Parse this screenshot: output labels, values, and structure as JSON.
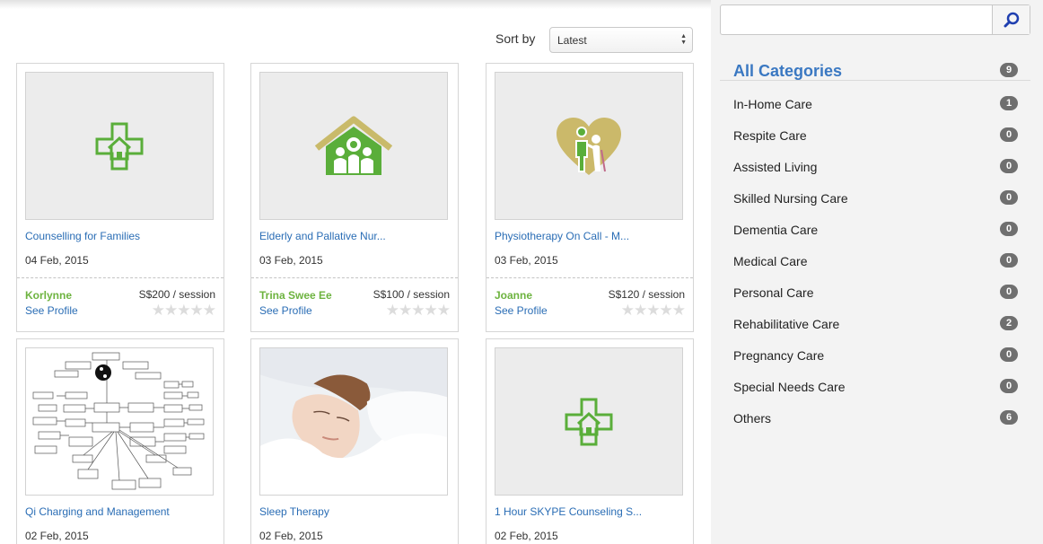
{
  "sort": {
    "label": "Sort by",
    "selected": "Latest"
  },
  "search": {
    "placeholder": ""
  },
  "categories_header": {
    "label": "All Categories",
    "count": "9"
  },
  "categories": [
    {
      "label": "In-Home Care",
      "count": "1"
    },
    {
      "label": "Respite Care",
      "count": "0"
    },
    {
      "label": "Assisted Living",
      "count": "0"
    },
    {
      "label": "Skilled Nursing Care",
      "count": "0"
    },
    {
      "label": "Dementia Care",
      "count": "0"
    },
    {
      "label": "Medical Care",
      "count": "0"
    },
    {
      "label": "Personal Care",
      "count": "0"
    },
    {
      "label": "Rehabilitative Care",
      "count": "2"
    },
    {
      "label": "Pregnancy Care",
      "count": "0"
    },
    {
      "label": "Special Needs Care",
      "count": "0"
    },
    {
      "label": "Others",
      "count": "6"
    }
  ],
  "listings": [
    {
      "title": "Counselling for Families",
      "date": "04 Feb, 2015",
      "provider": "Korlynne",
      "price": "S$200 / session",
      "profile_link": "See Profile",
      "image": "medical-house-icon",
      "rating": 0
    },
    {
      "title": "Elderly and Pallative Nur...",
      "date": "03 Feb, 2015",
      "provider": "Trina Swee Ee",
      "price": "S$100 / session",
      "profile_link": "See Profile",
      "image": "family-home-icon",
      "rating": 0
    },
    {
      "title": "Physiotherapy On Call - M...",
      "date": "03 Feb, 2015",
      "provider": "Joanne",
      "price": "S$120 / session",
      "profile_link": "See Profile",
      "image": "heart-caregiver-icon",
      "rating": 0
    },
    {
      "title": "Qi Charging and Management",
      "date": "02 Feb, 2015",
      "image": "qi-diagram-image"
    },
    {
      "title": "Sleep Therapy",
      "date": "02 Feb, 2015",
      "image": "sleeping-woman-photo"
    },
    {
      "title": "1 Hour SKYPE Counseling S...",
      "date": "02 Feb, 2015",
      "image": "medical-house-icon"
    }
  ],
  "colors": {
    "link": "#2a6db5",
    "provider": "#6db33f",
    "accent_green": "#5aae3a",
    "badge": "#6f6f6f",
    "category_header": "#3a78c2"
  }
}
